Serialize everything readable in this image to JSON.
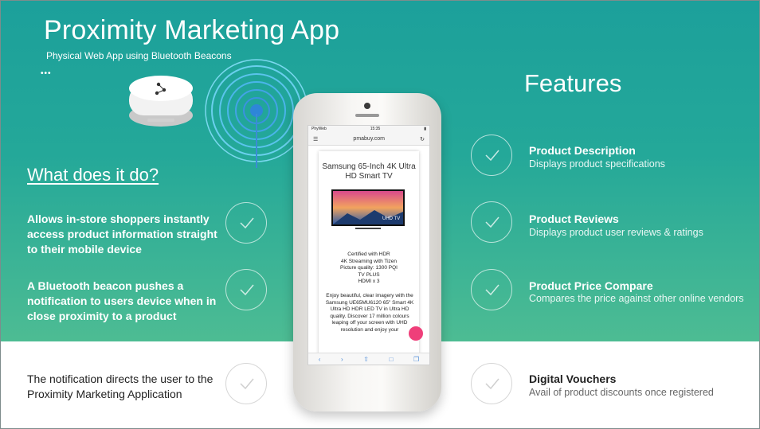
{
  "header": {
    "title": "Proximity Marketing App",
    "subtitle": "Physical Web App using Bluetooth Beacons"
  },
  "left": {
    "heading": "What does it do?",
    "items": [
      "Allows in-store shoppers instantly access product information straight to their mobile device",
      "A Bluetooth beacon pushes a notification to users device when in close proximity to a product",
      "The notification directs the user to the Proximity Marketing Application"
    ]
  },
  "features": {
    "heading": "Features",
    "items": [
      {
        "title": "Product Description",
        "desc": "Displays product specifications"
      },
      {
        "title": "Product Reviews",
        "desc": "Displays product user reviews & ratings"
      },
      {
        "title": "Product Price Compare",
        "desc": "Compares the price against other online vendors"
      },
      {
        "title": "Digital Vouchers",
        "desc": "Avail of product discounts once registered"
      }
    ]
  },
  "phone": {
    "carrier": "PhyWeb",
    "time": "15:35",
    "url": "pmabuy.com",
    "product_title": "Samsung 65-Inch 4K Ultra HD Smart TV",
    "tv_badge": "UHD TV",
    "specs": [
      "Certified with HDR",
      "4K Streaming with Tizen",
      "Picture quality: 1300 PQI",
      "TV PLUS",
      "HDMI x 3"
    ],
    "description": "Enjoy beautiful, clear imagery with the Samsung UE65MU6120 65\" Smart 4K Ultra HD HDR LED TV in Ultra HD quality. Discover 17 million colours leaping off your screen with UHD resolution and enjoy your"
  },
  "icons": {
    "check": "check-icon",
    "beacon": "beacon-device-icon",
    "signal": "signal-waves-icon"
  },
  "colors": {
    "teal_top": "#1ca09b",
    "teal_bottom": "#4dbc93",
    "fab_pink": "#ef3f7a"
  }
}
